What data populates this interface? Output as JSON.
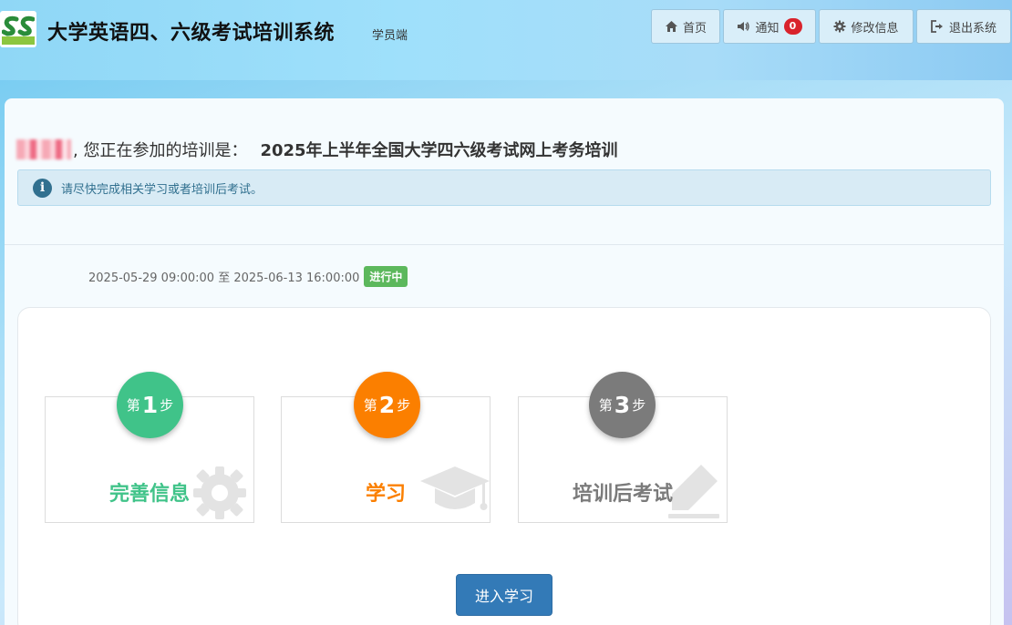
{
  "header": {
    "title": "大学英语四、六级考试培训系统",
    "subtitle": "学员端",
    "logo_icon": "logo-icon",
    "nav": {
      "home": "首页",
      "notice": "通知",
      "notice_count": "0",
      "settings": "修改信息",
      "logout": "退出系统"
    }
  },
  "welcome": {
    "prefix": ", 您正在参加的培训是：",
    "training_name": "2025年上半年全国大学四六级考试网上考务培训"
  },
  "alert": {
    "text": "请尽快完成相关学习或者培训后考试。"
  },
  "schedule": {
    "range": "2025-05-29 09:00:00 至 2025-06-13 16:00:00",
    "status": "进行中"
  },
  "steps": [
    {
      "pre": "第",
      "num": "1",
      "post": "步",
      "title": "完善信息",
      "color": "#40c389",
      "icon": "gear-icon"
    },
    {
      "pre": "第",
      "num": "2",
      "post": "步",
      "title": "学习",
      "color": "#fb7f00",
      "icon": "graduation-cap-icon"
    },
    {
      "pre": "第",
      "num": "3",
      "post": "步",
      "title": "培训后考试",
      "color": "#7b7b7b",
      "icon": "pencil-icon"
    }
  ],
  "action": {
    "enter_label": "进入学习"
  },
  "colors": {
    "primary": "#337ab7",
    "success": "#5cb85c",
    "danger": "#d9232c",
    "info": "#31708f"
  }
}
